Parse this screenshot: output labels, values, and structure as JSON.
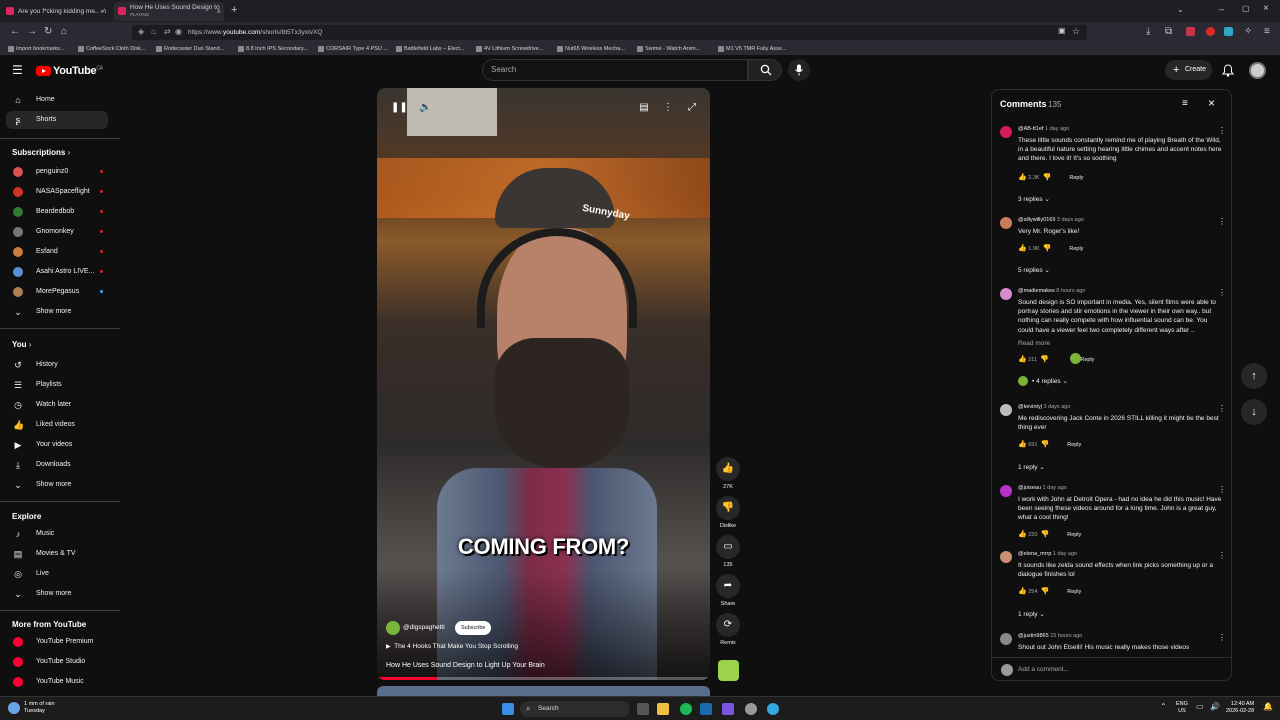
{
  "browser": {
    "tabs": [
      {
        "title": "Are you f*cking kidding me.. - \\",
        "active": false
      },
      {
        "title": "How He Uses Sound Design to",
        "subtitle": "PLAYING",
        "active": true
      }
    ],
    "url_prefix": "https://www.",
    "url_domain": "youtube.com",
    "url_path": "/shorts/tb5Tx3yxIvXQ",
    "bookmarks": [
      "Import bookmarks...",
      "CoffeeSock Cloth Disk...",
      "Rodecaster Duo Stand...",
      "8.8 Inch IPS Secondary...",
      "CORSAIR Type 4 PSU ...",
      "Battlefield Labs – Elect...",
      "4V Lithium Screwdrive...",
      "Nut65 Wireless Mecha...",
      "Swime - Watch Anim...",
      "M1 V5 TMR Fully Asse..."
    ]
  },
  "header": {
    "logo": "YouTube",
    "logo_region": "CA",
    "search_placeholder": "Search",
    "create_label": "Create"
  },
  "sidebar": {
    "main": [
      {
        "label": "Home",
        "icon": "home-icon"
      },
      {
        "label": "Shorts",
        "icon": "shorts-icon",
        "active": true
      }
    ],
    "subscriptions_title": "Subscriptions",
    "subscriptions": [
      {
        "label": "penguinz0",
        "color": "#d9534f"
      },
      {
        "label": "NASASpaceflight",
        "color": "#d0312d"
      },
      {
        "label": "Beardedbob",
        "color": "#2e7d32"
      },
      {
        "label": "Gnomonkey",
        "color": "#777777"
      },
      {
        "label": "Esfand",
        "color": "#c97c3c"
      },
      {
        "label": "Asahi Astro LIVE...",
        "color": "#5b8fd6"
      },
      {
        "label": "MorePegasus",
        "color": "#b0814e"
      }
    ],
    "show_more": "Show more",
    "you_title": "You",
    "you": [
      {
        "label": "History",
        "icon": "history-icon"
      },
      {
        "label": "Playlists",
        "icon": "playlists-icon"
      },
      {
        "label": "Watch later",
        "icon": "clock-icon"
      },
      {
        "label": "Liked videos",
        "icon": "thumbs-up-icon"
      },
      {
        "label": "Your videos",
        "icon": "video-icon"
      },
      {
        "label": "Downloads",
        "icon": "download-icon"
      },
      {
        "label": "Show more",
        "icon": "chevron-down-icon"
      }
    ],
    "explore_title": "Explore",
    "explore": [
      {
        "label": "Music",
        "icon": "music-icon"
      },
      {
        "label": "Movies & TV",
        "icon": "film-icon"
      },
      {
        "label": "Live",
        "icon": "live-icon"
      },
      {
        "label": "Show more",
        "icon": "chevron-down-icon"
      }
    ],
    "more_title": "More from YouTube",
    "more": [
      {
        "label": "YouTube Premium"
      },
      {
        "label": "YouTube Studio"
      },
      {
        "label": "YouTube Music"
      }
    ]
  },
  "video": {
    "caption": "COMING FROM?",
    "channel": "@digspaghetti",
    "subscribe": "Subscribe",
    "related": "The 4 Hooks That Make You Stop Scrolling",
    "title": "How He Uses Sound Design to Light Up Your Brain",
    "progress": 0.18
  },
  "actions": {
    "like_count": "27K",
    "dislike": "Dislike",
    "comments_count": "135",
    "share": "Share",
    "remix": "Remix"
  },
  "comments": {
    "title": "Comments",
    "count": "135",
    "add_placeholder": "Add a comment...",
    "reply_label": "Reply",
    "items": [
      {
        "author": "@AB-tt1ef",
        "time": "1 day ago",
        "text": "These little sounds constantly remind me of playing Breath of the Wild, in a beautiful nature setting hearing little chimes and accent notes here and there. I love it! It's so soothing",
        "likes": "2.3K",
        "replies": "3 replies",
        "color": "#d81b60"
      },
      {
        "author": "@sillywilly0169",
        "time": "3 days ago",
        "text": "Very Mr. Roger's like!",
        "likes": "1.9K",
        "replies": "5 replies",
        "color": "#c97c5c"
      },
      {
        "author": "@madiemakes",
        "time": "8 hours ago",
        "text": "Sound design is SO important in media. Yes, silent films were able to portray stories and stir emotions in the viewer in their own way.. but nothing can really compete with how influential sound can be. You could have a viewer feel two completely different ways after ..",
        "read_more": "Read more",
        "likes": "211",
        "replies": "4 replies",
        "color": "#d98ad0"
      },
      {
        "author": "@kevintyj",
        "time": "3 days ago",
        "text": "Me rediscovering Jack Conte in 2026 STILL killing it might be the best thing ever",
        "likes": "691",
        "replies": "1 reply",
        "color": "#bdbdbd"
      },
      {
        "author": "@joiseau",
        "time": "1 day ago",
        "text": "I work with John at Detroit Opera - had no idea he did this music! Have been seeing these videos around for a long time. John is a great guy, what a cool thing!",
        "likes": "220",
        "replies": "",
        "color": "#b832c8"
      },
      {
        "author": "@elena_mrrp",
        "time": "1 day ago",
        "text": "It sounds like zelda sound effects when link picks something up or a dialogue finishes lol",
        "likes": "254",
        "replies": "1 reply",
        "color": "#c89070"
      },
      {
        "author": "@justin9865",
        "time": "15 hours ago",
        "text": "Shout out John Etselli! His music really makes those videos",
        "likes": "",
        "replies": "",
        "color": "#8a8a8a"
      }
    ]
  },
  "taskbar": {
    "weather_line1": "1 mm of rain",
    "weather_line2": "Tuesday",
    "search": "Search",
    "lang_line1": "ENG",
    "lang_line2": "US",
    "time": "12:40 AM",
    "date": "2026-02-28"
  }
}
